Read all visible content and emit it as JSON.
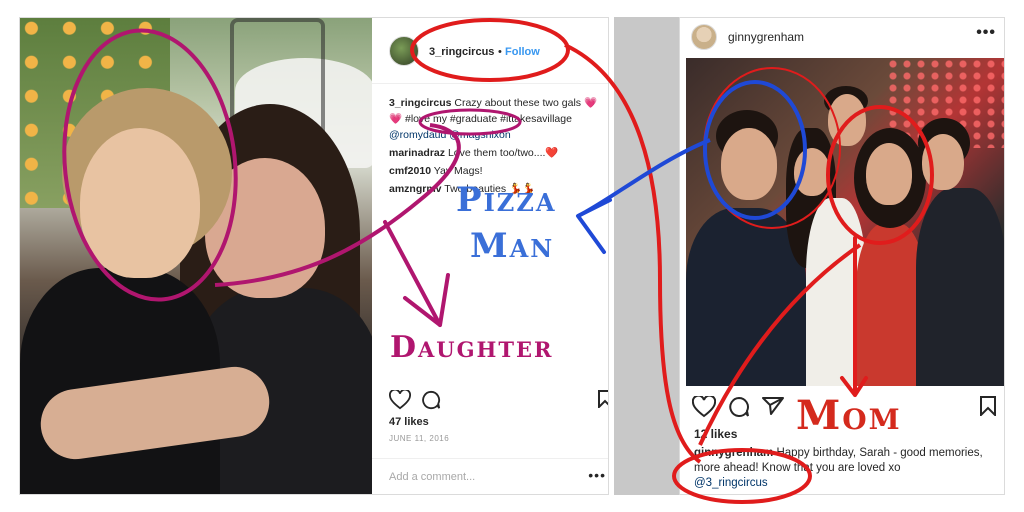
{
  "left_post": {
    "username": "3_ringcircus",
    "separator": "•",
    "follow_label": "Follow",
    "comments": [
      {
        "user": "3_ringcircus",
        "text": "Crazy about these two gals 💗💗 #love my #graduate #ittakesavillage",
        "mentions": "@romydaud @magsnixon"
      },
      {
        "user": "marinadraz",
        "text": "Love them too/two....❤️"
      },
      {
        "user": "cmf2010",
        "text": "Yay Mags!"
      },
      {
        "user": "amzngrmv",
        "text": "Two beauties 💃💃"
      }
    ],
    "likes": "47 likes",
    "date": "JUNE 11, 2016",
    "add_comment_placeholder": "Add a comment...",
    "more_glyph": "•••"
  },
  "right_post": {
    "username": "ginnygrenham",
    "more_glyph": "•••",
    "likes": "12 likes",
    "caption_user": "ginnygrenham",
    "caption_text": "Happy birthday, Sarah - good memories, more ahead! Know that you are loved xo",
    "caption_mention": "@3_ringcircus"
  },
  "annotations": {
    "pizza": "Pizza",
    "man": "Man",
    "daughter": "Daughter",
    "mom": "Mom"
  },
  "colors": {
    "instagram_link": "#3897f0",
    "annotation_blue": "#3a6fd8",
    "annotation_magenta": "#b0166f",
    "annotation_red": "#d42a1d",
    "divider_gray": "#c8c8c8"
  },
  "icons": [
    "heart-icon",
    "comment-icon",
    "share-icon",
    "bookmark-icon",
    "more-icon"
  ]
}
